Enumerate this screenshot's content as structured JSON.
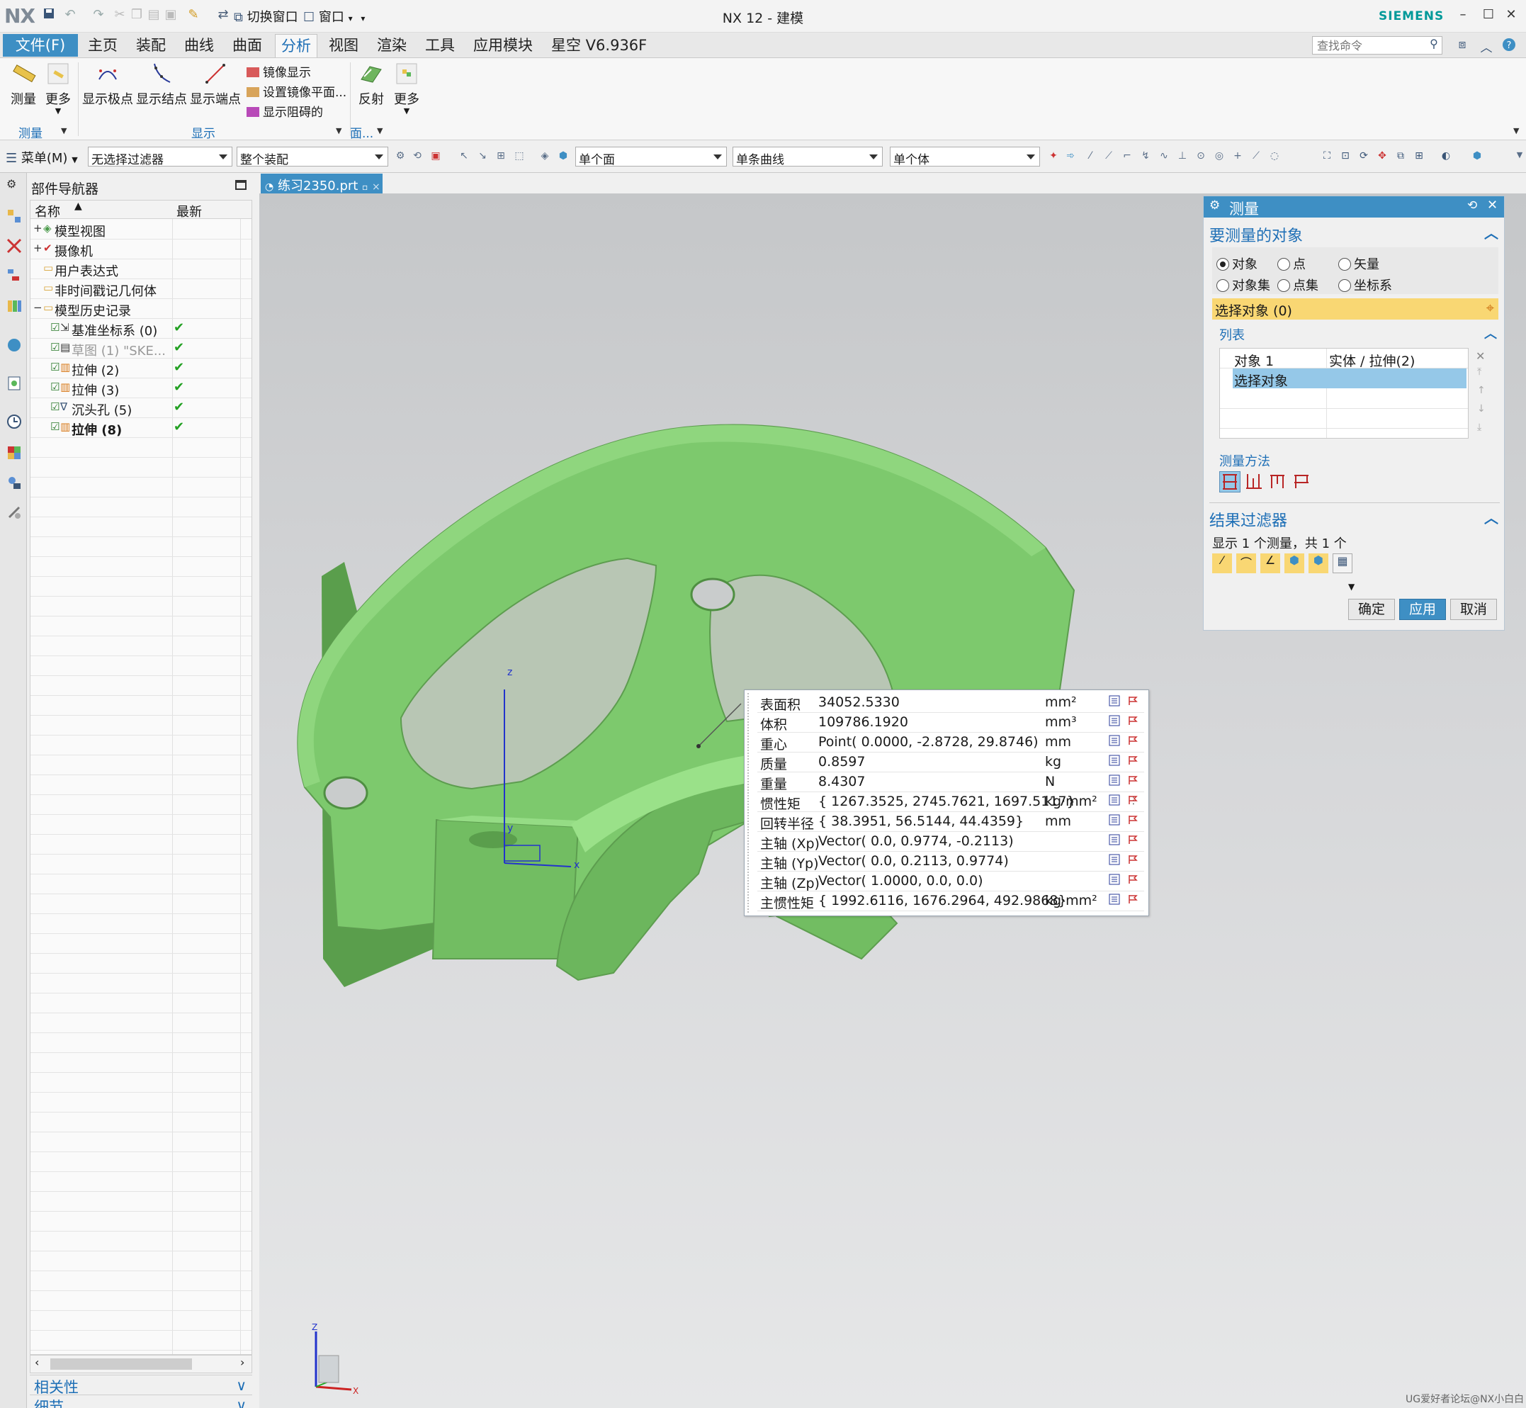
{
  "titlebar": {
    "logo": "NX",
    "switch_window": "切换窗口",
    "window_menu": "窗口",
    "title": "NX 12 - 建模",
    "brand": "SIEMENS"
  },
  "tabs": {
    "file": "文件(F)",
    "items": [
      "主页",
      "装配",
      "曲线",
      "曲面",
      "分析",
      "视图",
      "渲染",
      "工具",
      "应用模块",
      "星空 V6.936F"
    ],
    "active": "分析",
    "search_placeholder": "查找命令"
  },
  "ribbon": {
    "measure": "测量",
    "more": "更多",
    "show_poles": "显示极点",
    "show_knots": "显示结点",
    "show_endpoints": "显示端点",
    "mirror_display": "镜像显示",
    "set_mirror_plane": "设置镜像平面...",
    "show_obstruction": "显示阻碍的",
    "reflect": "反射",
    "more2": "更多",
    "group_measure": "测量",
    "group_display": "显示",
    "group_face": "面..."
  },
  "selbar": {
    "menu": "菜单(M)",
    "filter": "无选择过滤器",
    "assembly": "整个装配",
    "face": "单个面",
    "curve": "单条曲线",
    "body": "单个体"
  },
  "navigator": {
    "title": "部件导航器",
    "col_name": "名称",
    "col_latest": "最新",
    "rows": [
      {
        "label": "模型视图",
        "checked": false
      },
      {
        "label": "摄像机",
        "checked": false
      },
      {
        "label": "用户表达式",
        "checked": false
      },
      {
        "label": "非时间戳记几何体",
        "checked": false
      },
      {
        "label": "模型历史记录",
        "checked": false
      },
      {
        "label": "基准坐标系 (0)",
        "checked": true
      },
      {
        "label": "草图 (1) \"SKE...",
        "checked": true
      },
      {
        "label": "拉伸 (2)",
        "checked": true
      },
      {
        "label": "拉伸 (3)",
        "checked": true
      },
      {
        "label": "沉头孔 (5)",
        "checked": true
      },
      {
        "label": "拉伸 (8)",
        "checked": true
      }
    ],
    "check_mark": "✔",
    "relations": "相关性",
    "details": "细节"
  },
  "document": {
    "tab": "练习2350.prt"
  },
  "measure_panel": {
    "title": "测量",
    "objects_header": "要测量的对象",
    "radio_object": "对象",
    "radio_point": "点",
    "radio_vector": "矢量",
    "radio_objectset": "对象集",
    "radio_pointset": "点集",
    "radio_csys": "坐标系",
    "select_object": "选择对象 (0)",
    "list_header": "列表",
    "list_rows": [
      {
        "col1": "对象 1",
        "col2": "实体 / 拉伸(2)"
      },
      {
        "col1": "选择对象",
        "col2": ""
      }
    ],
    "method_header": "测量方法",
    "filter_header": "结果过滤器",
    "filter_info": "显示 1 个测量，共 1 个",
    "ok": "确定",
    "apply": "应用",
    "cancel": "取消"
  },
  "results": [
    {
      "name": "表面积",
      "value": "34052.5330",
      "unit": "mm²"
    },
    {
      "name": "体积",
      "value": "109786.1920",
      "unit": "mm³"
    },
    {
      "name": "重心",
      "value": "Point( 0.0000, -2.8728, 29.8746)",
      "unit": "mm"
    },
    {
      "name": "质量",
      "value": "0.8597",
      "unit": "kg"
    },
    {
      "name": "重量",
      "value": "8.4307",
      "unit": "N"
    },
    {
      "name": "惯性矩",
      "value": "{ 1267.3525, 2745.7621, 1697.5117}",
      "unit": "kg·mm²"
    },
    {
      "name": "回转半径",
      "value": "{ 38.3951, 56.5144, 44.4359}",
      "unit": "mm"
    },
    {
      "name": "主轴 (Xp)",
      "value": "Vector( 0.0, 0.9774, -0.2113)",
      "unit": ""
    },
    {
      "name": "主轴 (Yp)",
      "value": "Vector( 0.0, 0.2113, 0.9774)",
      "unit": ""
    },
    {
      "name": "主轴 (Zp)",
      "value": "Vector( 1.0000, 0.0, 0.0)",
      "unit": ""
    },
    {
      "name": "主惯性矩",
      "value": "{ 1992.6116, 1676.2964, 492.9868}",
      "unit": "kg·mm²"
    }
  ],
  "triad": {
    "x": "X",
    "y": "Y",
    "z": "Z",
    "x_small": "x",
    "y_small": "y",
    "z_small": "z"
  },
  "watermark": "UG爱好者论坛@NX小白白",
  "colors": {
    "accent": "#3e8fc4",
    "model": "#7dc96d",
    "select_highlight": "#f9d773",
    "check": "#22a022"
  },
  "icons": {
    "save": "save-icon",
    "undo": "undo-icon",
    "redo": "redo-icon",
    "measure": "ruler-icon",
    "reflect": "reflection-icon"
  }
}
